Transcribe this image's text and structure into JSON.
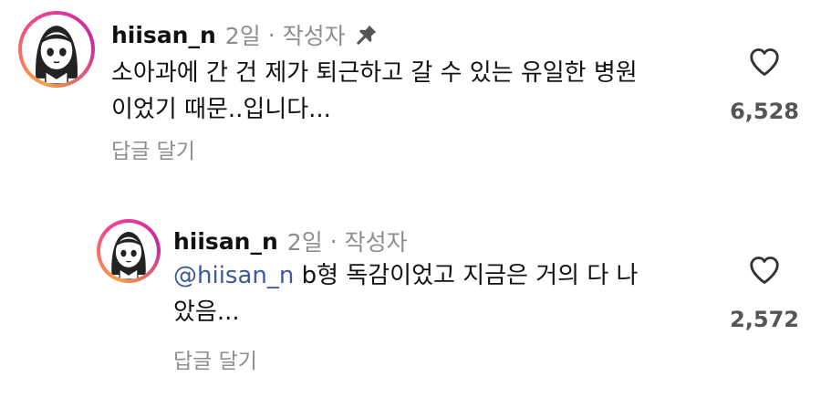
{
  "comments": [
    {
      "username": "hiisan_n",
      "time": "2일",
      "separator": "·",
      "author_tag": "작성자",
      "pinned": true,
      "text_line1": "소아과에 간 건 제가 퇴근하고 갈 수 있는 유일한 병원",
      "text_line2": "이었기 때문..입니다...",
      "reply_label": "답글 달기",
      "like_count": "6,528"
    },
    {
      "username": "hiisan_n",
      "time": "2일",
      "separator": "·",
      "author_tag": "작성자",
      "mention": "@hiisan_n",
      "text_line1": " b형 독감이었고 지금은 거의 다 나",
      "text_line2": "았음...",
      "reply_label": "답글 달기",
      "like_count": "2,572"
    }
  ],
  "icons": {
    "like": "heart-outline-icon",
    "pin": "pin-icon",
    "avatar": "cartoon-girl-avatar"
  },
  "colors": {
    "mention": "#3d5a96",
    "secondary_text": "#8e8e8e",
    "avatar_ring": [
      "#f9a03f",
      "#f1458c",
      "#c32aa3"
    ]
  }
}
